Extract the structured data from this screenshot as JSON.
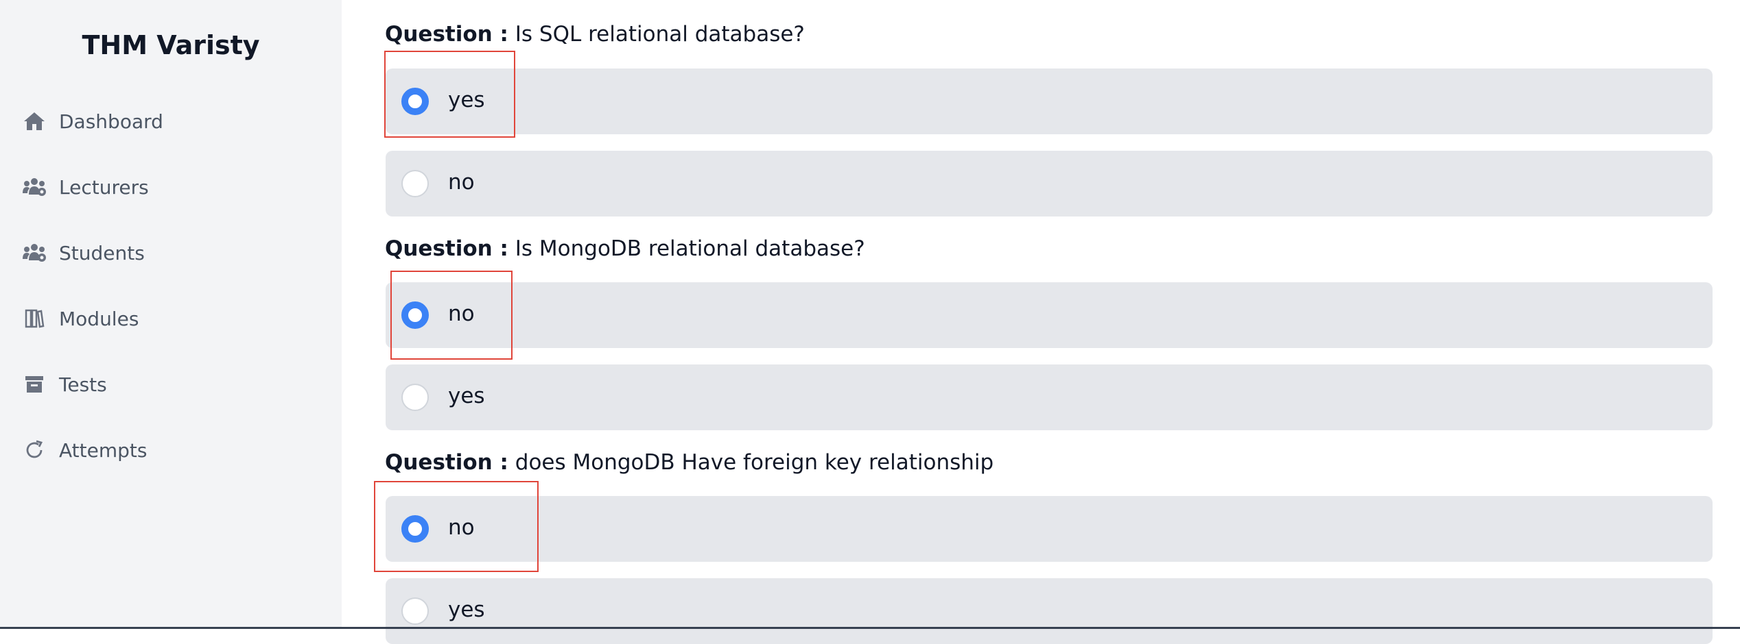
{
  "sidebar": {
    "brand": "THM Varisty",
    "items": [
      {
        "label": "Dashboard",
        "icon": "home-icon"
      },
      {
        "label": "Lecturers",
        "icon": "users-icon"
      },
      {
        "label": "Students",
        "icon": "users-icon"
      },
      {
        "label": "Modules",
        "icon": "books-icon"
      },
      {
        "label": "Tests",
        "icon": "archive-icon"
      },
      {
        "label": "Attempts",
        "icon": "refresh-icon"
      }
    ]
  },
  "questions": [
    {
      "prefix": "Question :",
      "text": "Is SQL relational database?",
      "options": [
        {
          "label": "yes",
          "selected": true
        },
        {
          "label": "no",
          "selected": false
        }
      ]
    },
    {
      "prefix": "Question :",
      "text": "Is MongoDB relational database?",
      "options": [
        {
          "label": "no",
          "selected": true
        },
        {
          "label": "yes",
          "selected": false
        }
      ]
    },
    {
      "prefix": "Question :",
      "text": "does MongoDB Have foreign key relationship",
      "options": [
        {
          "label": "no",
          "selected": true
        },
        {
          "label": "yes",
          "selected": false
        }
      ]
    }
  ],
  "colors": {
    "sidebar_bg": "#f3f4f6",
    "option_bg": "#e5e7eb",
    "radio_checked": "#3b82f6",
    "highlight_border": "#e0453a"
  }
}
